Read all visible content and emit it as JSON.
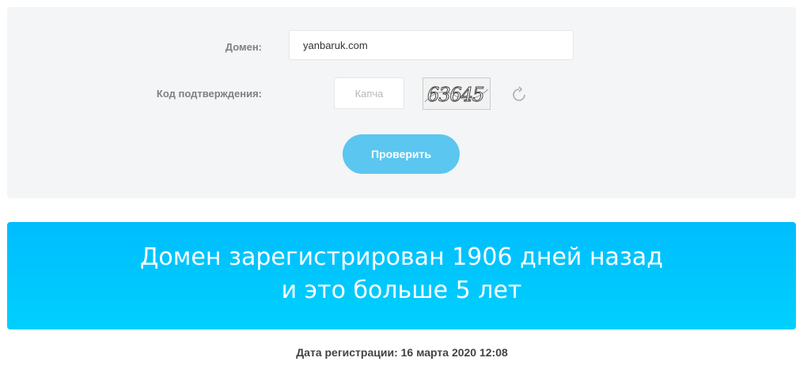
{
  "form": {
    "domain_label": "Домен:",
    "domain_value": "yanbaruk.com",
    "code_label": "Код подтверждения:",
    "captcha_placeholder": "Капча",
    "captcha_image_text": "63645",
    "refresh_icon": "refresh-icon",
    "submit_label": "Проверить"
  },
  "result": {
    "line1": "Домен зарегистрирован 1906 дней назад",
    "line2": "и это больше 5 лет"
  },
  "registration": {
    "date_text": "Дата регистрации: 16 марта 2020 12:08"
  },
  "colors": {
    "panel_bg": "#f3f5f6",
    "button_bg": "#5bc6ef",
    "banner_top": "#00bdfd",
    "banner_bottom": "#00d0fd"
  }
}
